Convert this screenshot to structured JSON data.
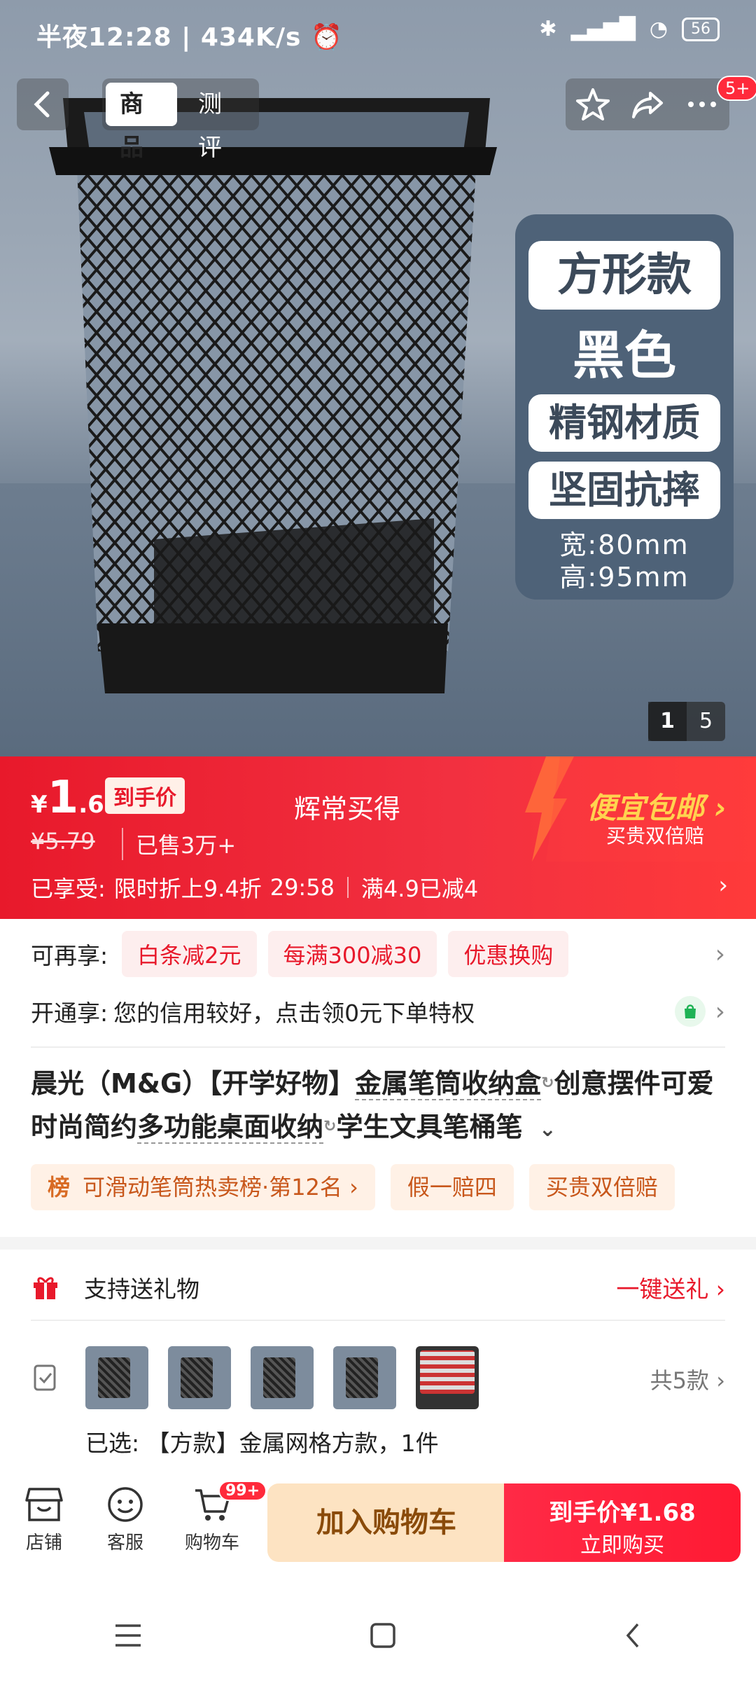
{
  "status_bar": {
    "time": "半夜12:28",
    "speed": "434K/s",
    "battery": "56"
  },
  "top_nav": {
    "tabs": [
      "商品",
      "测评"
    ],
    "notification_badge": "5+"
  },
  "hero": {
    "feature_panel": {
      "line1": "方形款",
      "line2": "黑色",
      "line3": "精钢材质",
      "line4": "坚固抗摔",
      "spec_width": "宽:80mm",
      "spec_height": "高:95mm"
    },
    "page_current": "1",
    "page_total": "5"
  },
  "price": {
    "currency": "¥",
    "integer": "1",
    "decimal": ".68",
    "tag": "到手价",
    "original": "¥5.79",
    "sold": "已售3万+",
    "center_label": "辉常买得",
    "promo_title": "便宜包邮",
    "promo_sub": "买贵双倍赔",
    "enjoyed_label": "已享受:",
    "discount_text": "限时折上9.4折",
    "countdown": "29:58",
    "threshold_text": "满4.9已减4"
  },
  "more_offers": {
    "label": "可再享:",
    "chips": [
      "白条减2元",
      "每满300减30",
      "优惠换购"
    ]
  },
  "credit": {
    "label": "开通享:",
    "text": "您的信用较好，点击领0元下单特权"
  },
  "product_title": {
    "part1": "晨光（M&G）【开学好物】",
    "link1": "金属笔筒收纳盒",
    "part2": "创意摆件可爱时尚简约",
    "link2": "多功能桌面收纳",
    "part3": "学生文具笔桶笔"
  },
  "badges": {
    "rank_icon": "榜",
    "rank_text": "可滑动笔筒热卖榜·第12名",
    "b2": "假一赔四",
    "b3": "买贵双倍赔"
  },
  "gift": {
    "label": "支持送礼物",
    "action": "一键送礼"
  },
  "sku": {
    "count": "共5款",
    "selected_label": "已选:",
    "selected_value": "【方款】金属网格方款，1件"
  },
  "bottom_bar": {
    "shop": "店铺",
    "service": "客服",
    "cart": "购物车",
    "cart_badge": "99+",
    "add_to_cart": "加入购物车",
    "buy_price_label": "到手价",
    "buy_price": "¥1.68",
    "buy_now": "立即购买"
  },
  "colors": {
    "accent_red": "#e8192b",
    "banner_gradient_end": "#ff3a3a",
    "add_cart_bg": "#fde3c2"
  }
}
